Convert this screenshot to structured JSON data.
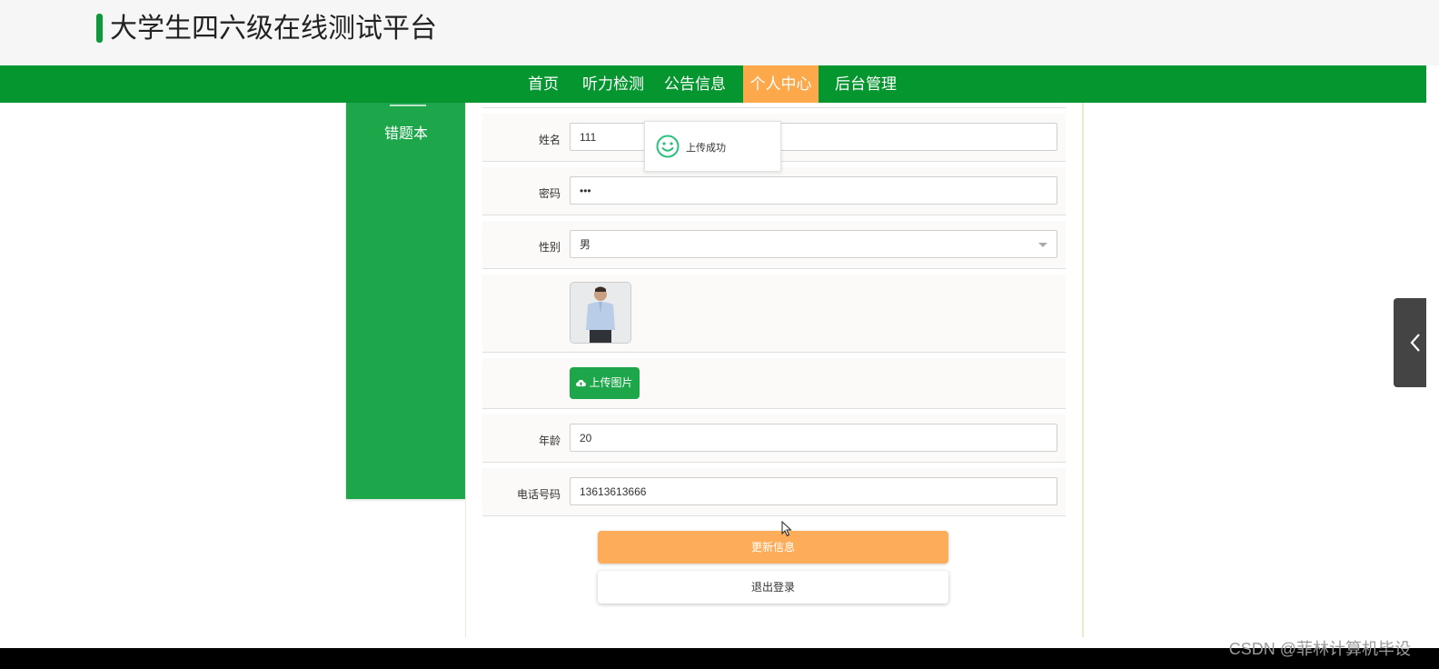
{
  "site": {
    "title": "大学生四六级在线测试平台"
  },
  "nav": {
    "items": [
      {
        "label": "首页"
      },
      {
        "label": "听力检测"
      },
      {
        "label": "公告信息"
      },
      {
        "label": "个人中心"
      },
      {
        "label": "后台管理"
      }
    ],
    "active_index": 3
  },
  "sidebar": {
    "items": [
      {
        "label": "错题本"
      }
    ]
  },
  "form": {
    "name_label": "姓名",
    "name_value": "111",
    "password_label": "密码",
    "password_value": "•••",
    "gender_label": "性别",
    "gender_value": "男",
    "upload_label": "上传图片",
    "age_label": "年龄",
    "age_value": "20",
    "phone_label": "电话号码",
    "phone_value": "13613613666",
    "update_label": "更新信息",
    "logout_label": "退出登录"
  },
  "toast": {
    "message": "上传成功"
  },
  "watermark": "CSDN @菲林计算机毕设",
  "colors": {
    "nav_green": "#06962f",
    "sidebar_green": "#1ea64b",
    "active_orange": "#fda84a",
    "update_orange": "#fdad5a"
  },
  "icons": {
    "upload": "cloud-upload-icon",
    "toast": "smile-icon",
    "side_tab": "chevron-left-icon"
  }
}
